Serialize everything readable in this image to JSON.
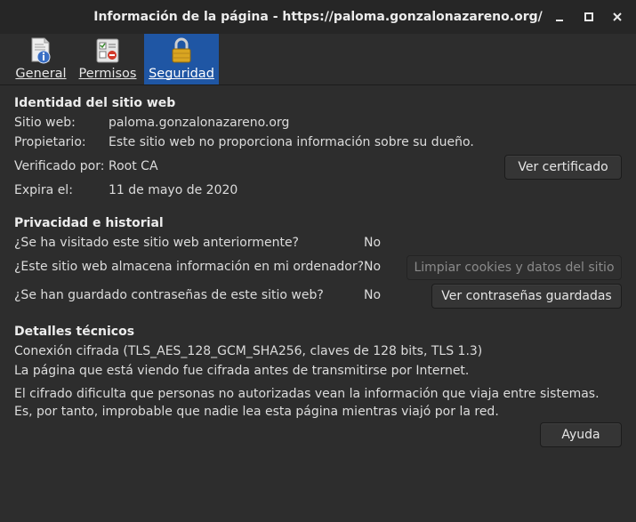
{
  "window": {
    "title": "Información de la página - https://paloma.gonzalonazareno.org/"
  },
  "tabs": [
    {
      "label": "General",
      "icon": "document-info-icon"
    },
    {
      "label": "Permisos",
      "icon": "permissions-icon"
    },
    {
      "label": "Seguridad",
      "icon": "padlock-icon",
      "active": true
    }
  ],
  "identity": {
    "title": "Identidad del sitio web",
    "website_label": "Sitio web:",
    "website_value": "paloma.gonzalonazareno.org",
    "owner_label": "Propietario:",
    "owner_value": "Este sitio web no proporciona información sobre su dueño.",
    "verified_label": "Verificado por:",
    "verified_value": "Root CA",
    "expires_label": "Expira el:",
    "expires_value": "11 de mayo de 2020",
    "view_cert_button": "Ver certificado"
  },
  "privacy": {
    "title": "Privacidad e historial",
    "q1": "¿Se ha visitado este sitio web anteriormente?",
    "a1": "No",
    "q2": "¿Este sitio web almacena información en mi ordenador?",
    "a2": "No",
    "q3": "¿Se han guardado contraseñas de este sitio web?",
    "a3": "No",
    "clear_cookies_button": "Limpiar cookies y datos del sitio",
    "view_passwords_button": "Ver contraseñas guardadas"
  },
  "technical": {
    "title": "Detalles técnicos",
    "line1": "Conexión cifrada (TLS_AES_128_GCM_SHA256, claves de 128 bits, TLS 1.3)",
    "line2": "La página que está viendo fue cifrada antes de transmitirse por Internet.",
    "line3": "El cifrado dificulta que personas no autorizadas vean la información que viaja entre sistemas. Es, por tanto, improbable que nadie lea esta página mientras viajó por la red."
  },
  "help_button": "Ayuda",
  "colors": {
    "background": "#2d2d2d",
    "titlebar": "#262626",
    "active_tab": "#1f56a4"
  }
}
